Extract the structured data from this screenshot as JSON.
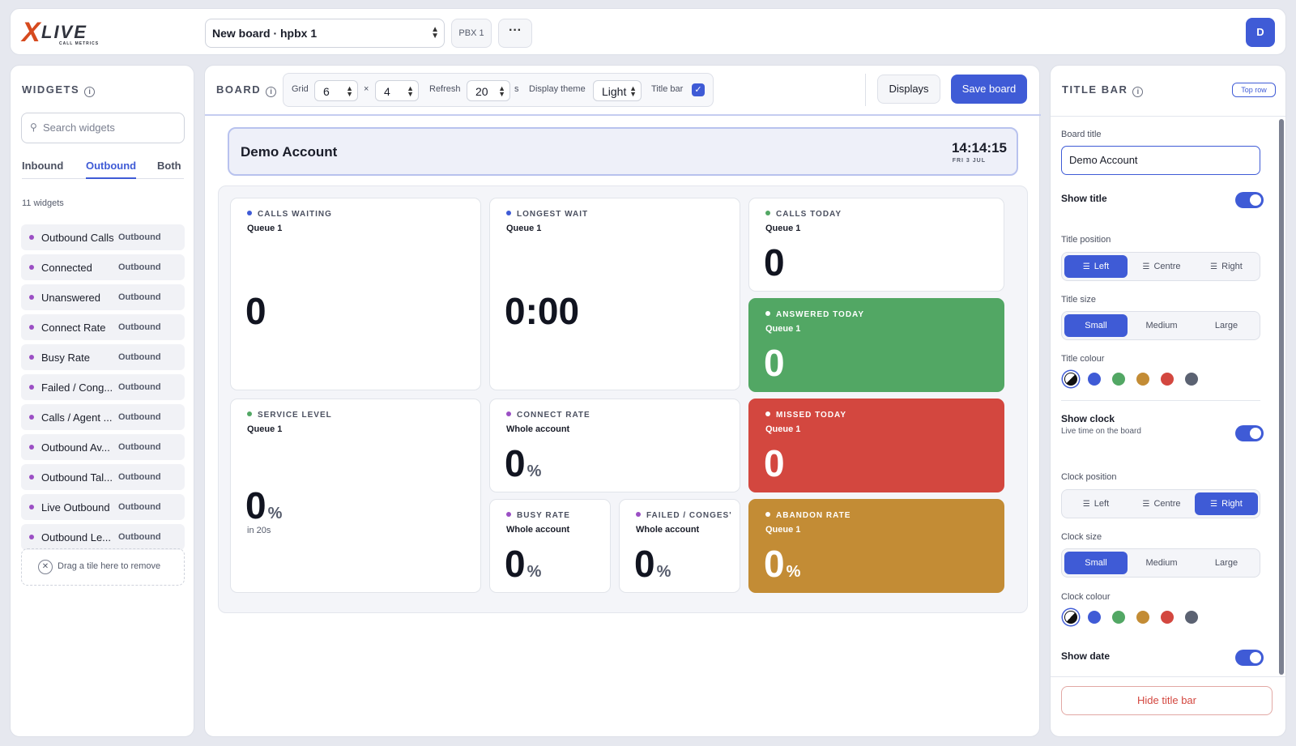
{
  "brand": {
    "logo_x": "X",
    "logo_live": "LIVE",
    "logo_sub": "CALL METRICS"
  },
  "topbar": {
    "board_select": "New board · hpbx 1",
    "pbx_tag": "PBX 1",
    "more": "···",
    "avatar": "D"
  },
  "left": {
    "heading": "WIDGETS",
    "search_placeholder": "Search widgets",
    "tabs": [
      "Inbound",
      "Outbound",
      "Both"
    ],
    "active_tab": "Outbound",
    "count": "11 widgets",
    "widgets": [
      {
        "name": "Outbound Calls",
        "tag": "Outbound"
      },
      {
        "name": "Connected",
        "tag": "Outbound"
      },
      {
        "name": "Unanswered",
        "tag": "Outbound"
      },
      {
        "name": "Connect Rate",
        "tag": "Outbound"
      },
      {
        "name": "Busy Rate",
        "tag": "Outbound"
      },
      {
        "name": "Failed / Cong...",
        "tag": "Outbound"
      },
      {
        "name": "Calls / Agent ...",
        "tag": "Outbound"
      },
      {
        "name": "Outbound Av...",
        "tag": "Outbound"
      },
      {
        "name": "Outbound Tal...",
        "tag": "Outbound"
      },
      {
        "name": "Live Outbound",
        "tag": "Outbound"
      },
      {
        "name": "Outbound Le...",
        "tag": "Outbound"
      }
    ],
    "dropzone": "Drag a tile here to remove"
  },
  "board": {
    "heading": "BOARD",
    "grid_label": "Grid",
    "grid_cols": "6",
    "grid_x": "×",
    "grid_rows": "4",
    "refresh_label": "Refresh",
    "refresh_value": "20",
    "refresh_unit": "s",
    "theme_label": "Display theme",
    "theme_value": "Light",
    "titlebar_label": "Title bar",
    "titlebar_checked": "✓",
    "displays_btn": "Displays",
    "save_btn": "Save board",
    "preview_title": "Demo Account",
    "preview_clock": "14:14:15",
    "preview_date": "FRI 3 JUL"
  },
  "tiles": {
    "calls_waiting": {
      "label": "CALLS WAITING",
      "sub": "Queue 1",
      "value": "0"
    },
    "longest_wait": {
      "label": "LONGEST WAIT",
      "sub": "Queue 1",
      "value": "0:00"
    },
    "calls_today": {
      "label": "CALLS TODAY",
      "sub": "Queue 1",
      "value": "0"
    },
    "answered_today": {
      "label": "ANSWERED TODAY",
      "sub": "Queue 1",
      "value": "0"
    },
    "service_level": {
      "label": "SERVICE LEVEL",
      "sub": "Queue 1",
      "value": "0",
      "unit": "%",
      "note": "in 20s"
    },
    "connect_rate": {
      "label": "CONNECT RATE",
      "sub": "Whole account",
      "value": "0",
      "unit": "%"
    },
    "missed_today": {
      "label": "MISSED TODAY",
      "sub": "Queue 1",
      "value": "0"
    },
    "busy_rate": {
      "label": "BUSY RATE",
      "sub": "Whole account",
      "value": "0",
      "unit": "%"
    },
    "failed_conges": {
      "label": "FAILED / CONGES'",
      "sub": "Whole account",
      "value": "0",
      "unit": "%"
    },
    "abandon_rate": {
      "label": "ABANDON RATE",
      "sub": "Queue 1",
      "value": "0",
      "unit": "%"
    }
  },
  "colors": {
    "accent": "#3f5bd6",
    "dot_blue": "#3f5bd6",
    "dot_green": "#52a764",
    "dot_purple": "#9b4fc4",
    "green": "#52a764",
    "red": "#d3473f",
    "amber": "#c38c35"
  },
  "right": {
    "heading": "TITLE BAR",
    "tag": "Top row",
    "board_title_label": "Board title",
    "board_title_value": "Demo Account",
    "show_title": "Show title",
    "title_position_label": "Title position",
    "title_position_options": [
      "Left",
      "Centre",
      "Right"
    ],
    "title_position_selected": "Left",
    "title_size_label": "Title size",
    "title_size_options": [
      "Small",
      "Medium",
      "Large"
    ],
    "title_size_selected": "Small",
    "title_colour_label": "Title colour",
    "show_clock": "Show clock",
    "show_clock_sub": "Live time on the board",
    "clock_position_label": "Clock position",
    "clock_position_options": [
      "Left",
      "Centre",
      "Right"
    ],
    "clock_position_selected": "Right",
    "clock_size_label": "Clock size",
    "clock_size_options": [
      "Small",
      "Medium",
      "Large"
    ],
    "clock_size_selected": "Small",
    "clock_colour_label": "Clock colour",
    "show_date": "Show date",
    "hide_btn": "Hide title bar",
    "swatch_colors": [
      "#3f5bd6",
      "#52a764",
      "#c38c35",
      "#d3473f",
      "#5b6272"
    ]
  }
}
